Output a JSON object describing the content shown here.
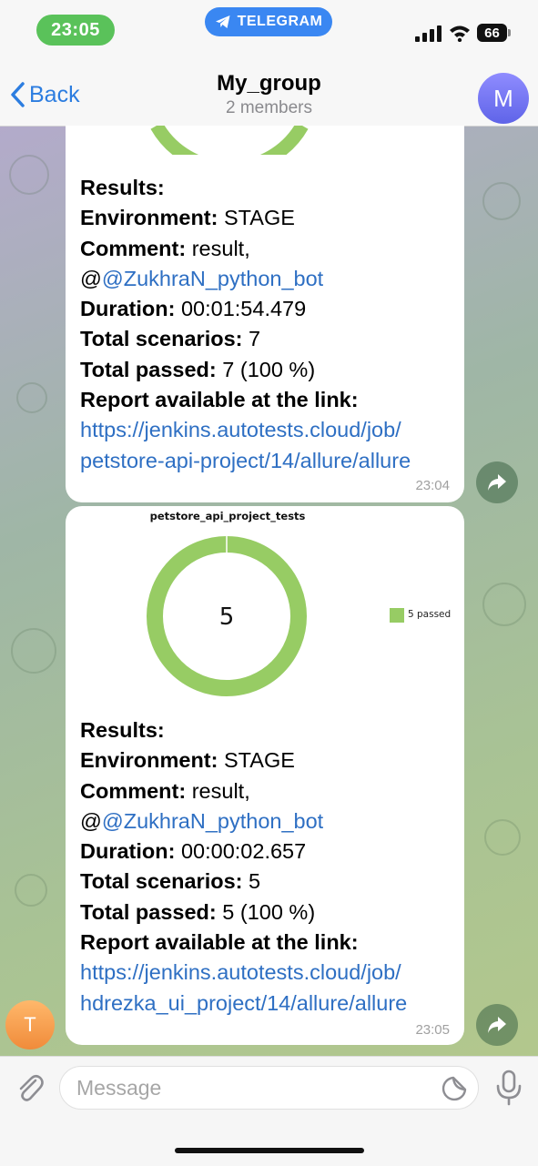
{
  "status_bar": {
    "time": "23:05",
    "app_pill": "TELEGRAM",
    "battery": "66"
  },
  "header": {
    "back_label": "Back",
    "title": "My_group",
    "subtitle": "2 members",
    "avatar_letter": "M"
  },
  "messages": [
    {
      "lines": [
        {
          "label": "Results:",
          "value": ""
        },
        {
          "label": "Environment:",
          "value": " STAGE"
        },
        {
          "label": "Comment:",
          "value": " result,"
        },
        {
          "prefix": "@",
          "link": "@ZukhraN_python_bot"
        },
        {
          "label": "Duration:",
          "value": " 00:01:54.479"
        },
        {
          "label": "Total scenarios:",
          "value": " 7"
        },
        {
          "label": "Total passed:",
          "value": " 7 (100 %)"
        },
        {
          "label": "Report available at the link:",
          "value": ""
        },
        {
          "link": "https://jenkins.autotests.cloud/job/"
        },
        {
          "link": "petstore-api-project/14/allure/allure"
        }
      ],
      "time": "23:04"
    },
    {
      "chart_title": "petstore_api_project_tests",
      "lines": [
        {
          "label": "Results:",
          "value": ""
        },
        {
          "label": "Environment:",
          "value": " STAGE"
        },
        {
          "label": "Comment:",
          "value": " result,"
        },
        {
          "prefix": "@",
          "link": "@ZukhraN_python_bot"
        },
        {
          "label": "Duration:",
          "value": " 00:00:02.657"
        },
        {
          "label": "Total scenarios:",
          "value": " 5"
        },
        {
          "label": "Total passed:",
          "value": " 5 (100 %)"
        },
        {
          "label": "Report available at the link:",
          "value": ""
        },
        {
          "link": "https://jenkins.autotests.cloud/job/"
        },
        {
          "link": "hdrezka_ui_project/14/allure/allure"
        }
      ],
      "time": "23:05"
    }
  ],
  "sender_avatar_letter": "T",
  "chart_data": {
    "type": "pie",
    "title": "petstore_api_project_tests",
    "center_label": "5",
    "categories": [
      "5 passed"
    ],
    "values": [
      5
    ],
    "colors": [
      "#97cc64"
    ],
    "legend_position": "right"
  },
  "input": {
    "placeholder": "Message"
  },
  "colors": {
    "accent": "#2c7de0",
    "passed": "#97cc64",
    "link": "#2e6fc3"
  }
}
